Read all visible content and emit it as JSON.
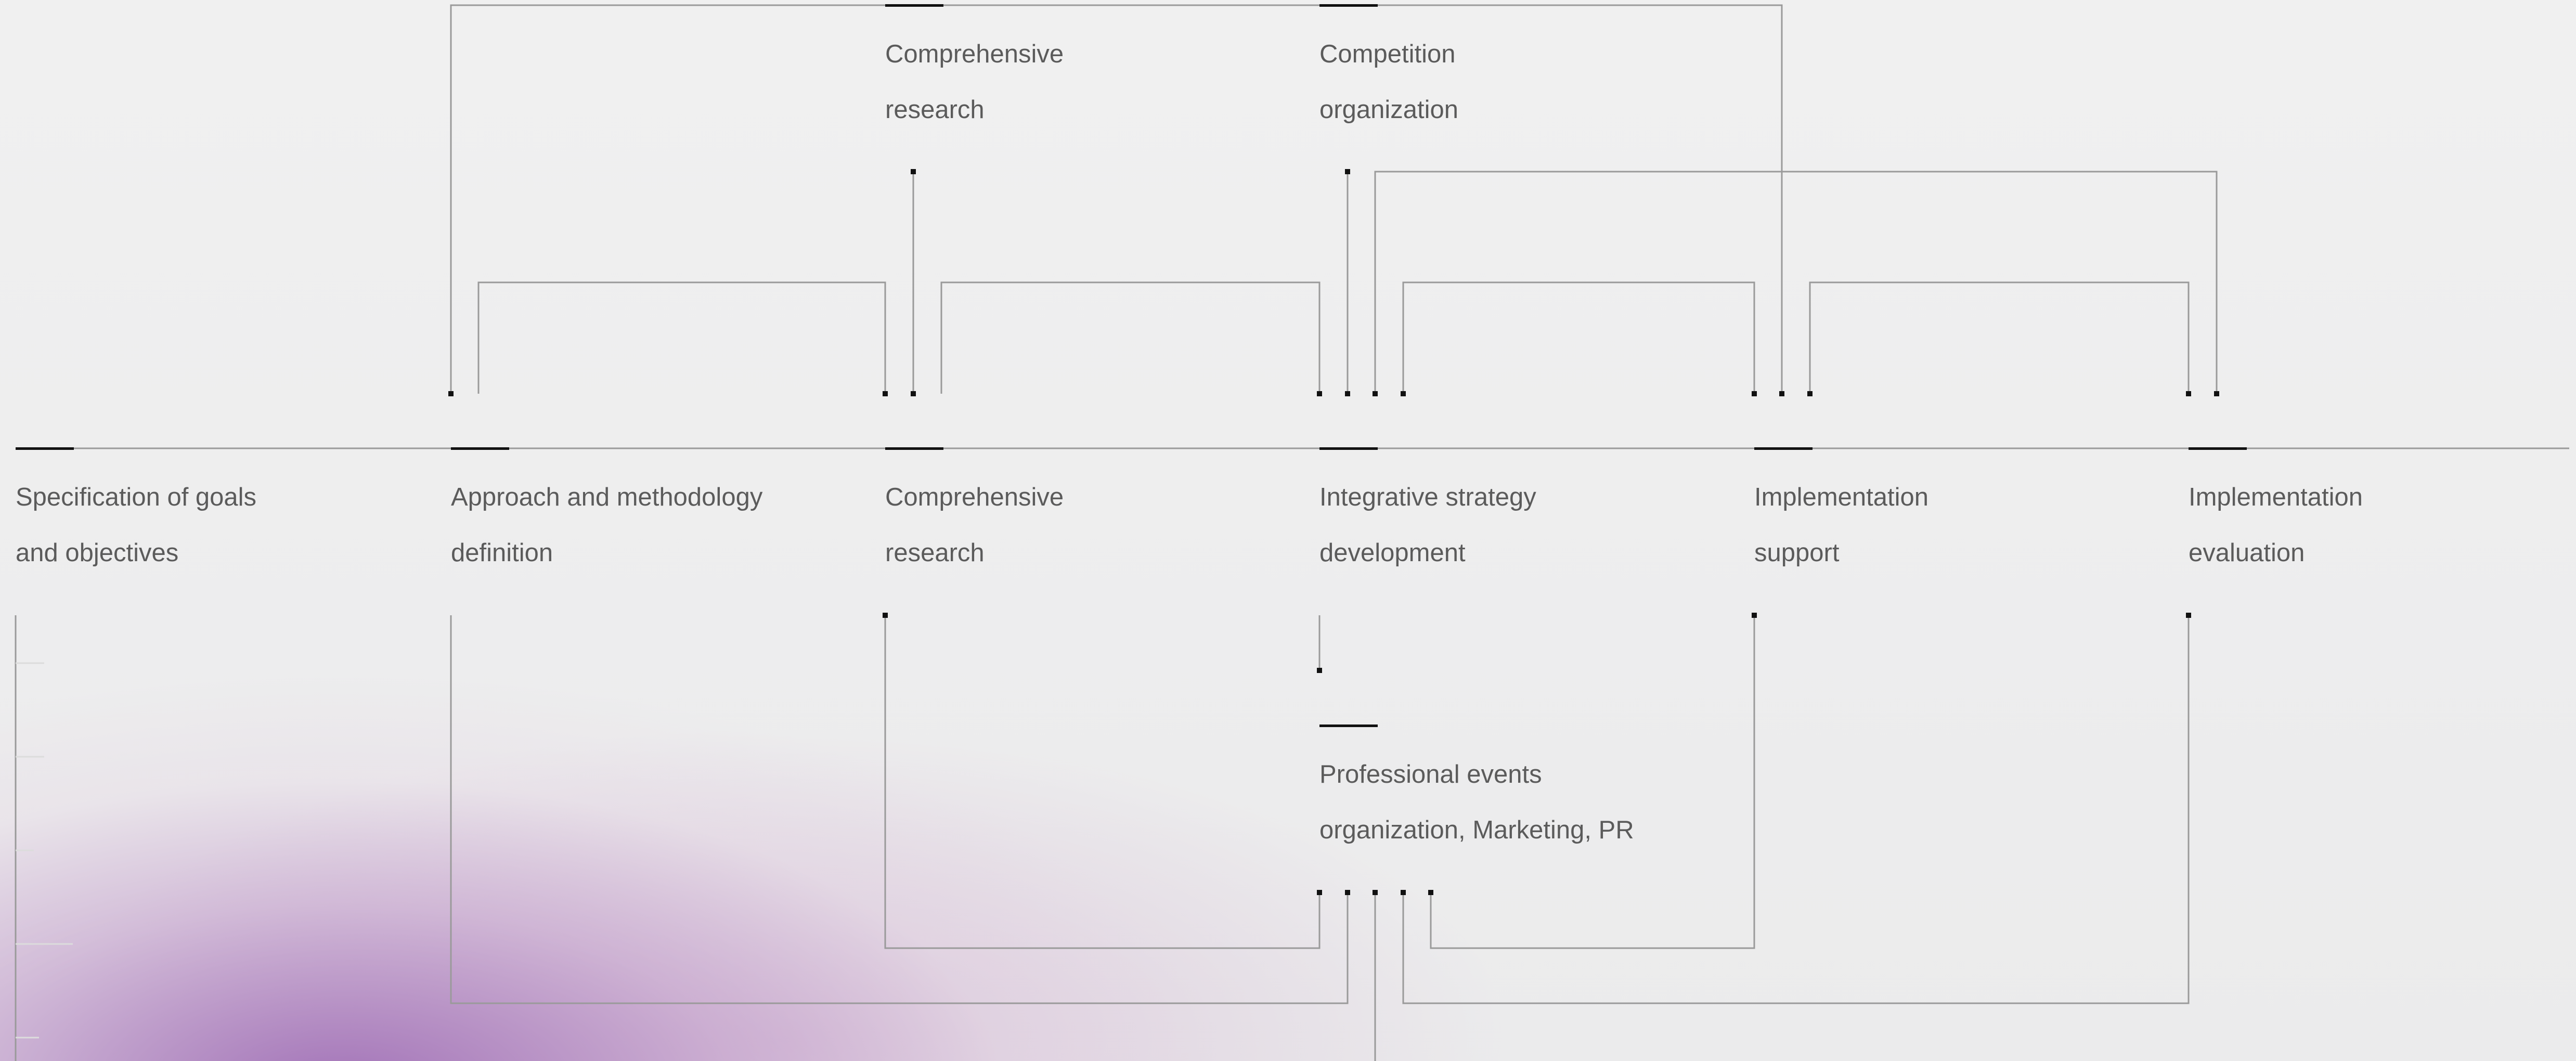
{
  "diagram": {
    "steps": [
      {
        "id": "goals",
        "line1": "Specification of goals",
        "line2": "and objectives"
      },
      {
        "id": "approach",
        "line1": "Approach and methodology",
        "line2": "definition"
      },
      {
        "id": "research",
        "line1": "Comprehensive",
        "line2": "research"
      },
      {
        "id": "strategy",
        "line1": "Integrative strategy",
        "line2": "development"
      },
      {
        "id": "support",
        "line1": "Implementation",
        "line2": "support"
      },
      {
        "id": "evaluation",
        "line1": "Implementation",
        "line2": "evaluation"
      }
    ],
    "top_nodes": [
      {
        "id": "top-research",
        "line1": "Comprehensive",
        "line2": "research"
      },
      {
        "id": "competition",
        "line1": "Competition",
        "line2": "organization"
      }
    ],
    "bottom_node": {
      "id": "events",
      "line1": "Professional events",
      "line2": "organization, Marketing, PR"
    }
  },
  "colors": {
    "wire": "#9a9a9a",
    "marker": "#111111",
    "text": "#5b5b5b"
  }
}
